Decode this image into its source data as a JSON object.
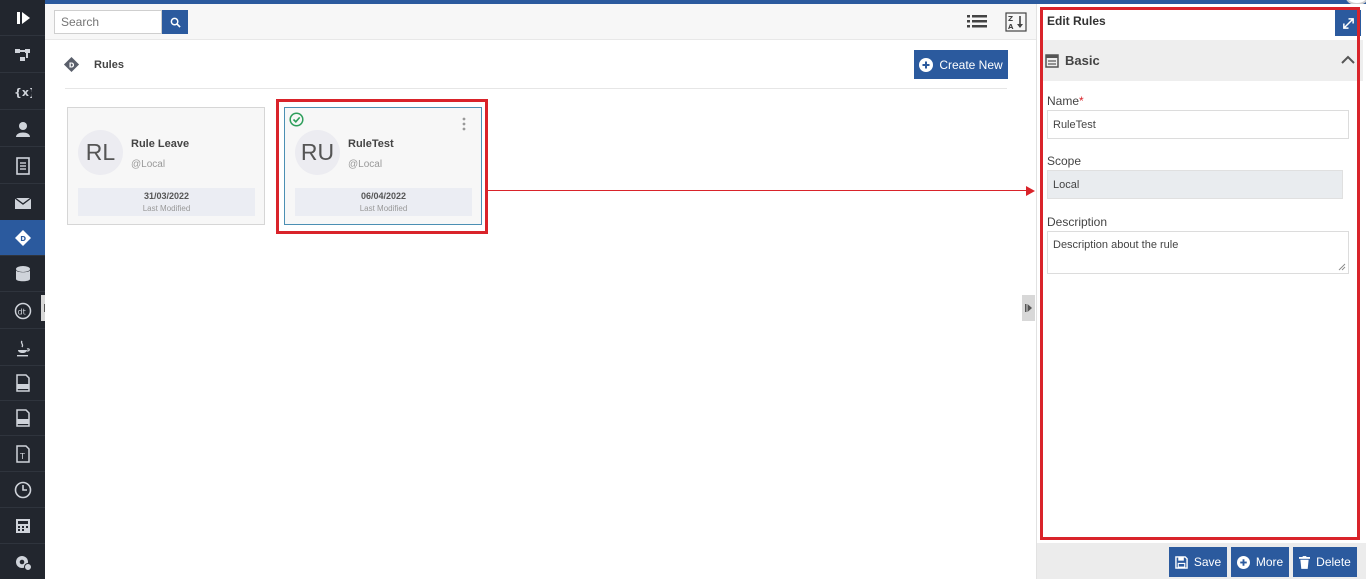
{
  "search": {
    "placeholder": "Search"
  },
  "page": {
    "title": "Rules",
    "create_label": "Create New"
  },
  "cards": [
    {
      "initials": "RL",
      "name": "Rule Leave",
      "scope": "@Local",
      "date": "31/03/2022",
      "date_label": "Last Modified"
    },
    {
      "initials": "RU",
      "name": "RuleTest",
      "scope": "@Local",
      "date": "06/04/2022",
      "date_label": "Last Modified"
    }
  ],
  "panel": {
    "title": "Edit Rules",
    "section": "Basic",
    "name_label": "Name",
    "name_required": "*",
    "name_value": "RuleTest",
    "scope_label": "Scope",
    "scope_value": "Local",
    "description_label": "Description",
    "description_value": "Description about the rule",
    "save_label": "Save",
    "more_label": "More",
    "delete_label": "Delete"
  },
  "colors": {
    "accent": "#2b5a9e",
    "highlight": "#d9232a",
    "nav_bg": "#22262e",
    "check": "#2e9e5b"
  },
  "nav_icons": [
    "logo-icon",
    "flow-icon",
    "variables-icon",
    "user-icon",
    "document-icon",
    "mail-icon",
    "rules-icon",
    "database-icon",
    "dt-icon",
    "java-icon",
    "txt-file-icon",
    "csv-file-icon",
    "text-template-icon",
    "clock-icon",
    "calculator-icon",
    "settings-icon"
  ]
}
